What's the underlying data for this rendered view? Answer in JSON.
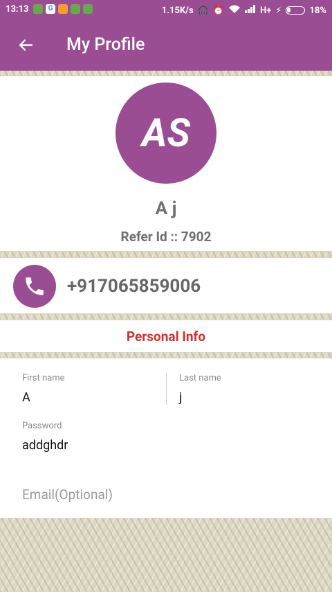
{
  "status": {
    "time": "13:13",
    "speed": "1.15K/s",
    "network": "H+",
    "battery": "18%",
    "notification_icons": [
      "app-icon-green",
      "google-icon",
      "app-icon-orange",
      "app-icon-green-2",
      "app-icon-green-3"
    ]
  },
  "toolbar": {
    "title": "My Profile"
  },
  "profile": {
    "initials": "AS",
    "name": "A j",
    "refer": "Refer Id :: 7902"
  },
  "contact": {
    "phone": "+917065859006"
  },
  "section": {
    "title": "Personal Info"
  },
  "form": {
    "first_name_label": "First name",
    "first_name_value": "A",
    "last_name_label": "Last name",
    "last_name_value": "j",
    "password_label": "Password",
    "password_value": "addghdr",
    "email_placeholder": "Email(Optional)"
  },
  "colors": {
    "primary": "#9a4d92",
    "accent_red": "#d0302f"
  }
}
